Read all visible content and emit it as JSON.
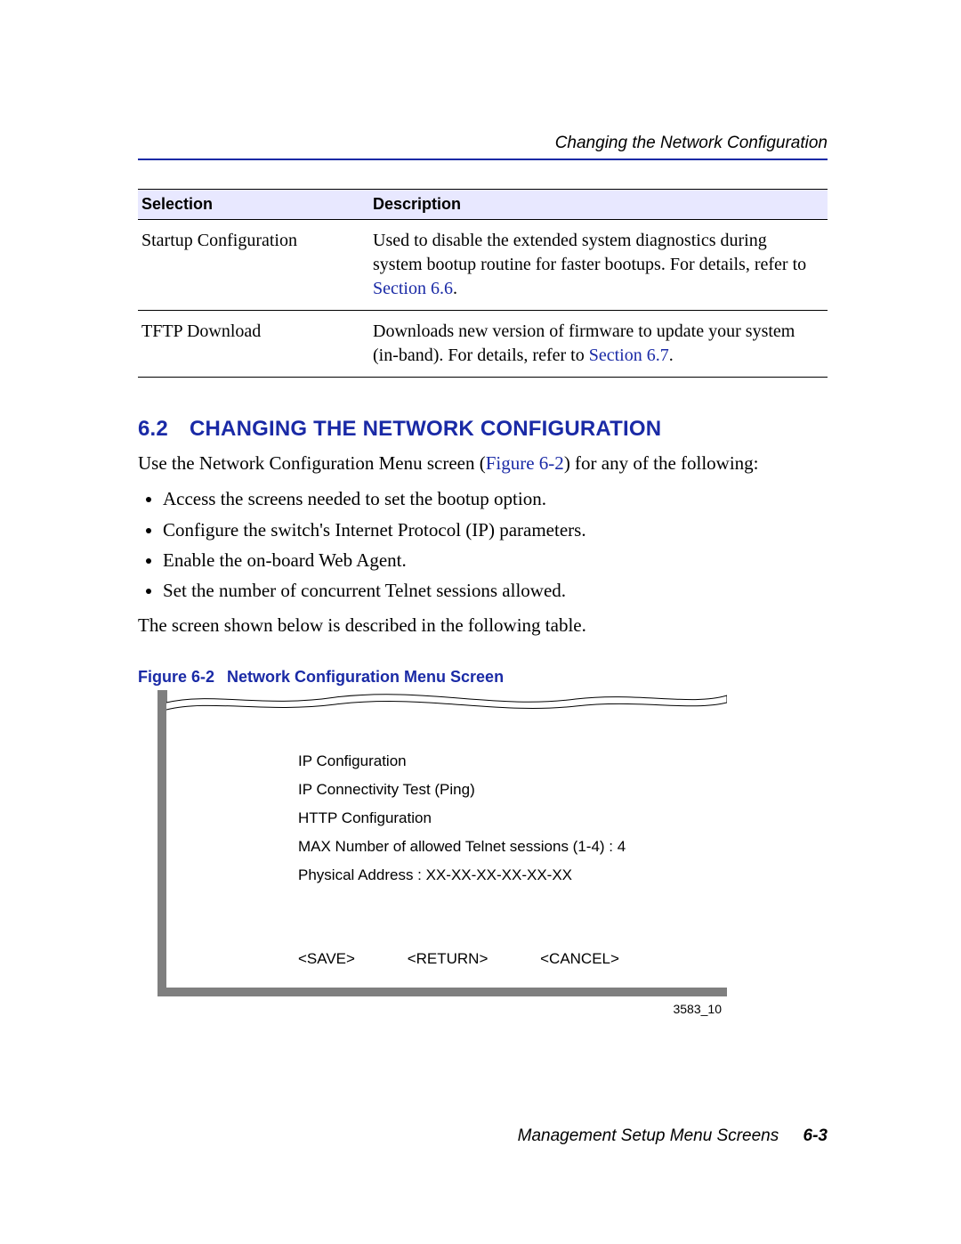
{
  "header": {
    "running_title": "Changing the Network Configuration"
  },
  "table": {
    "headers": {
      "col1": "Selection",
      "col2": "Description"
    },
    "rows": [
      {
        "selection": "Startup Configuration",
        "desc_before": "Used to disable the extended system diagnostics during system bootup routine for faster bootups. For details, refer to ",
        "link": "Section 6.6",
        "desc_after": "."
      },
      {
        "selection": "TFTP Download",
        "desc_before": "Downloads new version of firmware to update your system (in-band). For details, refer to ",
        "link": "Section 6.7",
        "desc_after": "."
      }
    ]
  },
  "section": {
    "number": "6.2",
    "title": "CHANGING THE NETWORK CONFIGURATION",
    "intro_before": "Use the Network Configuration Menu screen (",
    "intro_link": "Figure 6-2",
    "intro_after": ") for any of the following:",
    "bullets": [
      "Access the screens needed to set the bootup option.",
      "Configure the switch's Internet Protocol (IP) parameters.",
      "Enable the on-board Web Agent.",
      "Set the number of concurrent Telnet sessions allowed."
    ],
    "closing": "The screen shown below is described in the following table."
  },
  "figure": {
    "label": "Figure 6-2",
    "title": "Network Configuration Menu Screen",
    "id": "3583_10",
    "screen": {
      "lines": [
        "IP Configuration",
        "IP Connectivity Test (Ping)",
        "HTTP Configuration",
        "MAX Number of allowed Telnet sessions (1-4) : 4",
        "Physical Address : XX-XX-XX-XX-XX-XX"
      ],
      "buttons": {
        "save": "<SAVE>",
        "return": "<RETURN>",
        "cancel": "<CANCEL>"
      }
    }
  },
  "footer": {
    "text": "Management Setup Menu Screens",
    "page": "6-3"
  }
}
